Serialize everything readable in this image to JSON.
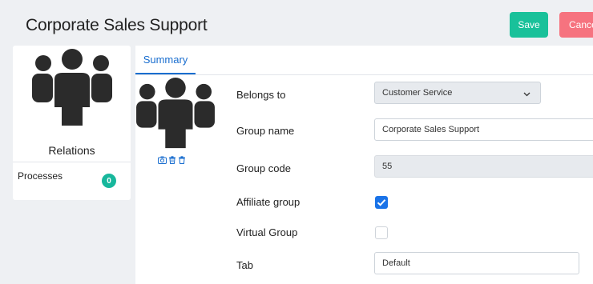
{
  "header": {
    "title": "Corporate Sales Support",
    "save_label": "Save",
    "cancel_label": "Cance"
  },
  "left_panel": {
    "section_title": "Relations",
    "items": [
      {
        "label": "Processes",
        "count": "0"
      }
    ]
  },
  "main": {
    "tabs": [
      {
        "label": "Summary",
        "active": true
      }
    ],
    "picture_tools": [
      "camera-icon",
      "trash-icon",
      "trash-icon"
    ],
    "form": {
      "belongs_to": {
        "label": "Belongs to",
        "value": "Customer Service"
      },
      "group_name": {
        "label": "Group name",
        "value": "Corporate Sales Support"
      },
      "group_code": {
        "label": "Group code",
        "value": "55"
      },
      "affiliate_group": {
        "label": "Affiliate group",
        "checked": true
      },
      "virtual_group": {
        "label": "Virtual Group",
        "checked": false
      },
      "tab": {
        "label": "Tab",
        "value": "Default"
      }
    }
  },
  "colors": {
    "accent": "#1a6ecf",
    "save": "#19c19a",
    "cancel": "#f6737f",
    "badge": "#17b79c",
    "avatar": "#2b2b2b"
  }
}
